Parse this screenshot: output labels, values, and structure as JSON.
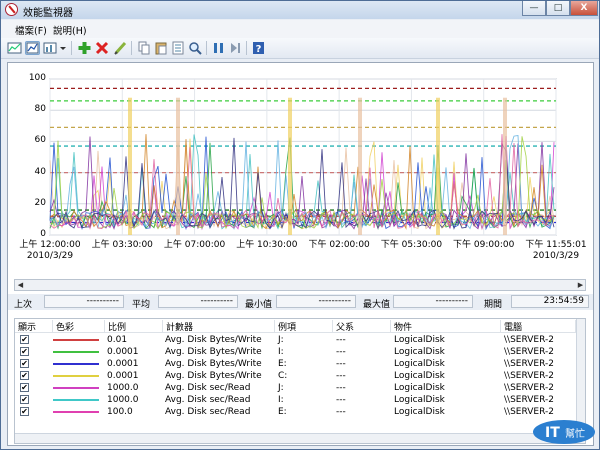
{
  "window": {
    "title": "效能監視器"
  },
  "titlebar_buttons": {
    "minimize": "—",
    "maximize": "□",
    "close": "X"
  },
  "menu": [
    {
      "label": "檔案(F)"
    },
    {
      "label": "說明(H)"
    }
  ],
  "toolbar": {
    "icons": [
      "graph-view-icon",
      "report-view-icon",
      "chart-type-icon",
      "dropdown-icon",
      "add-counter-icon",
      "delete-counter-icon",
      "highlight-icon",
      "copy-icon",
      "paste-icon",
      "properties-icon",
      "zoom-icon",
      "freeze-icon",
      "update-data-icon",
      "help-icon"
    ],
    "colors": {
      "add": "#2fa12a",
      "delete": "#d22",
      "pause": "#2f6fb4",
      "help": "#2f5fb0"
    }
  },
  "chart_data": {
    "type": "line",
    "ylim": [
      0,
      100
    ],
    "yticks": [
      "100",
      "80",
      "60",
      "40",
      "20",
      "0"
    ],
    "xticks": [
      {
        "time": "上午 12:00:00",
        "date": "2010/3/29"
      },
      {
        "time": "上午 03:30:00",
        "date": ""
      },
      {
        "time": "上午 07:00:00",
        "date": ""
      },
      {
        "time": "上午 10:30:00",
        "date": ""
      },
      {
        "time": "下午 02:00:00",
        "date": ""
      },
      {
        "time": "下午 05:30:00",
        "date": ""
      },
      {
        "time": "下午 09:00:00",
        "date": ""
      },
      {
        "time": "下午 11:55:01",
        "date": "2010/3/29"
      }
    ],
    "grid": true,
    "flat_series": [
      {
        "color": "#3ccc3c",
        "value": 86
      },
      {
        "color": "#9c1d1d",
        "value": 94
      },
      {
        "color": "#c4a64b",
        "value": 69
      },
      {
        "color": "#cc7777",
        "value": 40
      },
      {
        "color": "#1f7a1f",
        "value": 16
      },
      {
        "color": "#b03030",
        "value": 12
      },
      {
        "color": "#2a2ad0",
        "value": 8
      },
      {
        "color": "#2ab3b3",
        "value": 57
      }
    ],
    "spike_colors": [
      "#f0d060",
      "#e8c0a0",
      "#d040d0",
      "#2050d0",
      "#40c0c0",
      "#20a040",
      "#8030a0",
      "#d08020",
      "#60b0e0",
      "#a0d040",
      "#303080",
      "#e060a0"
    ]
  },
  "stats": {
    "last_label": "上次",
    "last_value": "----------",
    "avg_label": "平均",
    "avg_value": "----------",
    "min_label": "最小值",
    "min_value": "----------",
    "max_label": "最大值",
    "max_value": "----------",
    "duration_label": "期間",
    "duration_value": "23:54:59"
  },
  "table": {
    "headers": [
      "顯示",
      "色彩",
      "比例",
      "計數器",
      "例項",
      "父系",
      "物件",
      "電腦"
    ],
    "rows": [
      {
        "show": "✔",
        "color": "#d04040",
        "scale": "0.01",
        "counter": "Avg. Disk Bytes/Write",
        "instance": "J:",
        "parent": "---",
        "object": "LogicalDisk",
        "computer": "\\\\SERVER-2"
      },
      {
        "show": "✔",
        "color": "#40c040",
        "scale": "0.0001",
        "counter": "Avg. Disk Bytes/Write",
        "instance": "I:",
        "parent": "---",
        "object": "LogicalDisk",
        "computer": "\\\\SERVER-2"
      },
      {
        "show": "✔",
        "color": "#3030d0",
        "scale": "0.0001",
        "counter": "Avg. Disk Bytes/Write",
        "instance": "E:",
        "parent": "---",
        "object": "LogicalDisk",
        "computer": "\\\\SERVER-2"
      },
      {
        "show": "✔",
        "color": "#e0d040",
        "scale": "0.0001",
        "counter": "Avg. Disk Bytes/Write",
        "instance": "C:",
        "parent": "---",
        "object": "LogicalDisk",
        "computer": "\\\\SERVER-2"
      },
      {
        "show": "✔",
        "color": "#d040c0",
        "scale": "1000.0",
        "counter": "Avg. Disk sec/Read",
        "instance": "J:",
        "parent": "---",
        "object": "LogicalDisk",
        "computer": "\\\\SERVER-2"
      },
      {
        "show": "✔",
        "color": "#40c8c8",
        "scale": "1000.0",
        "counter": "Avg. Disk sec/Read",
        "instance": "I:",
        "parent": "---",
        "object": "LogicalDisk",
        "computer": "\\\\SERVER-2"
      },
      {
        "show": "✔",
        "color": "#e040b0",
        "scale": "100.0",
        "counter": "Avg. Disk sec/Read",
        "instance": "E:",
        "parent": "---",
        "object": "LogicalDisk",
        "computer": "\\\\SERVER-2"
      }
    ]
  }
}
